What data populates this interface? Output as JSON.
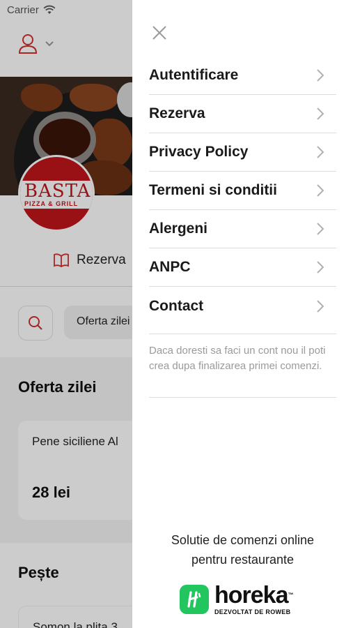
{
  "status_bar": {
    "carrier": "Carrier"
  },
  "background": {
    "logo": {
      "name": "BASTA",
      "tagline": "PIZZA & GRILL"
    },
    "tab_label": "Rezerva",
    "chip_label": "Oferta zilei",
    "section1": {
      "title": "Oferta zilei",
      "item_name": "Pene siciliene Al",
      "item_price": "28 lei"
    },
    "section2": {
      "title": "Pește",
      "item_name": "Somon la plita 3"
    }
  },
  "drawer": {
    "menu": [
      {
        "label": "Autentificare"
      },
      {
        "label": "Rezerva"
      },
      {
        "label": "Privacy Policy"
      },
      {
        "label": "Termeni si conditii"
      },
      {
        "label": "Alergeni"
      },
      {
        "label": "ANPC"
      },
      {
        "label": "Contact"
      }
    ],
    "note": "Daca doresti sa faci un cont nou il poti crea dupa finalizarea primei comenzi.",
    "footer_line1": "Solutie de comenzi online",
    "footer_line2": "pentru restaurante",
    "brand_name": "horeka",
    "brand_tm": "™",
    "brand_sub": "DEZVOLTAT DE ROWEB"
  },
  "colors": {
    "accent": "#d32f2f",
    "brand_green": "#22c55e"
  }
}
